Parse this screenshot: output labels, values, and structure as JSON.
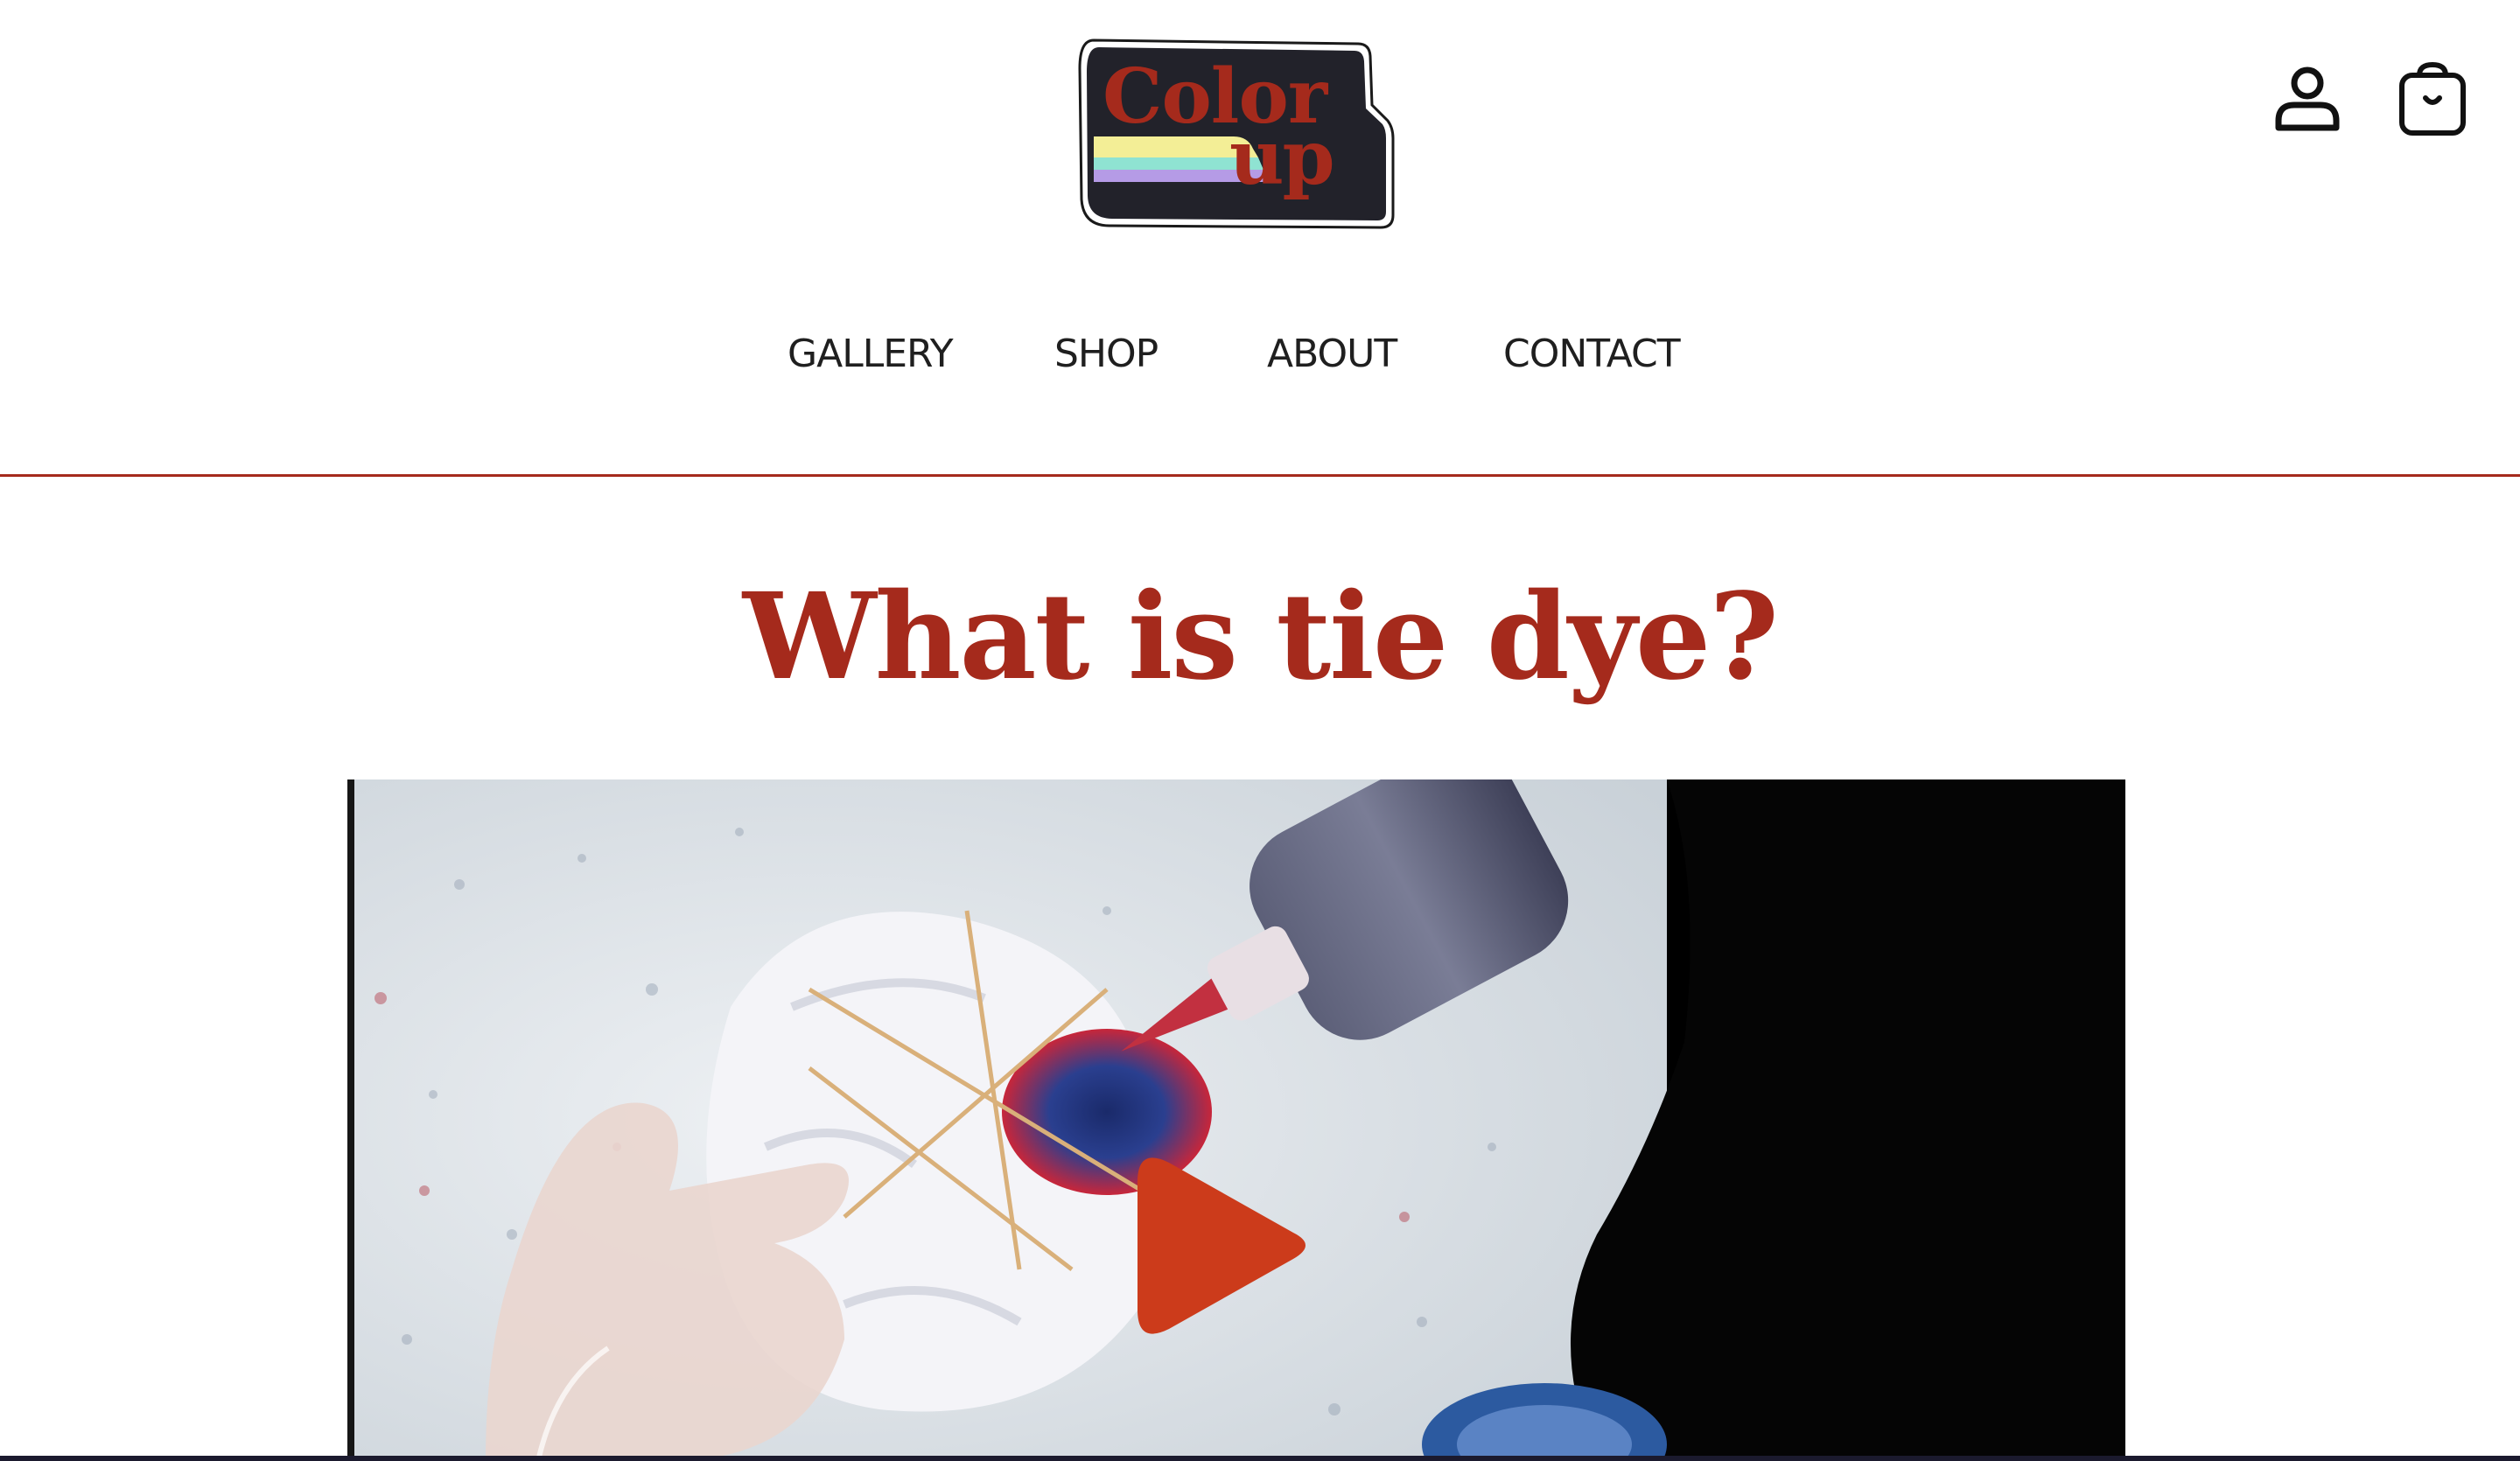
{
  "brand": {
    "logo_line1": "Color",
    "logo_line2": "up",
    "colors": {
      "brand_red": "#a52a1c",
      "logo_bg": "#22222a",
      "play_orange": "#cc3b1b",
      "stripe_yellow": "#f3ee96",
      "stripe_teal": "#8fe3d2",
      "stripe_purple": "#b59be6"
    }
  },
  "header": {
    "account_icon": "person-icon",
    "cart_icon": "shopping-bag-icon"
  },
  "nav": {
    "items": [
      {
        "label": "GALLERY"
      },
      {
        "label": "SHOP"
      },
      {
        "label": "ABOUT"
      },
      {
        "label": "CONTACT"
      }
    ]
  },
  "main": {
    "title": "What is tie dye?",
    "video": {
      "play_icon": "play-icon"
    }
  }
}
